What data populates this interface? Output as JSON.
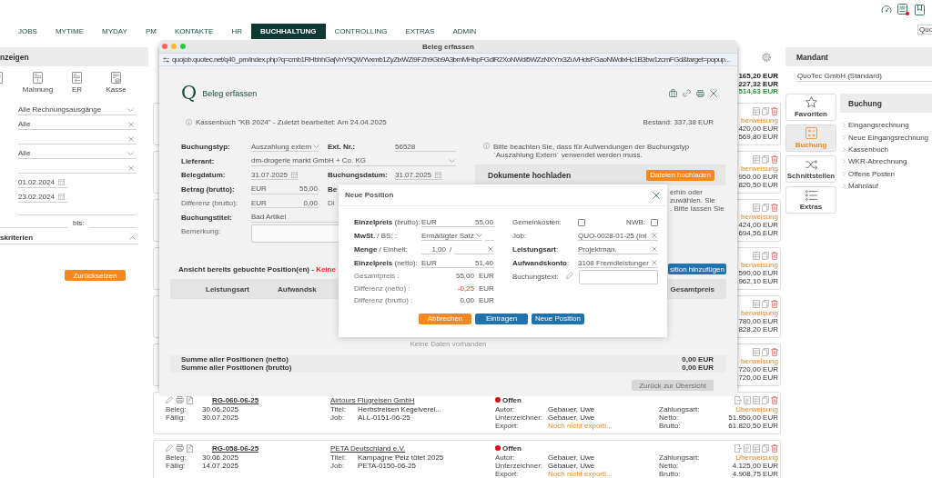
{
  "nav": {
    "tabs": [
      {
        "label": "JOBS",
        "selected": false
      },
      {
        "label": "MYTIME",
        "selected": false
      },
      {
        "label": "MYDAY",
        "selected": false
      },
      {
        "label": "PM",
        "selected": false
      },
      {
        "label": "KONTAKTE",
        "selected": false
      },
      {
        "label": "HR",
        "selected": false
      },
      {
        "label": "BUCHHALTUNG",
        "selected": true
      },
      {
        "label": "CONTROLLING",
        "selected": false
      },
      {
        "label": "EXTRAS",
        "selected": false
      },
      {
        "label": "ADMIN",
        "selected": false
      }
    ],
    "notification": true,
    "company_field": "Quo"
  },
  "left_panel": {
    "title": "nzeigen",
    "shortcuts": [
      "Mahnung",
      "ER",
      "Kasse"
    ],
    "filters": [
      {
        "kind": "select",
        "value": "Alle Rechnungsausgänge"
      },
      {
        "kind": "clearable",
        "value": "Alle"
      },
      {
        "kind": "clearable"
      },
      {
        "kind": "select",
        "value": "Alle"
      },
      {
        "kind": "clearable"
      },
      {
        "kind": "date",
        "value": "01.02.2024"
      },
      {
        "kind": "date",
        "value": "23.02.2024"
      },
      {
        "kind": "text"
      },
      {
        "kind": "range",
        "label": "bis:"
      }
    ],
    "section": {
      "title": "skriterien",
      "expanded": true
    },
    "reset_button": "Zurücksetzen"
  },
  "invoices": {
    "totals": [
      {
        "value": "165,20 EUR",
        "color": "#222222"
      },
      {
        "value": "227,32 EUR",
        "color": "#222222"
      },
      {
        "value": "514,63 EUR",
        "color": "#2e9b38"
      }
    ],
    "rows": [
      {
        "amounts": [
          {
            "value": "berweisung",
            "highlight": true
          },
          {
            "value": "420,00 EUR",
            "highlight": false
          },
          {
            "value": "569,80 EUR",
            "highlight": false
          }
        ]
      },
      {
        "amounts": [
          {
            "value": "berweisung",
            "highlight": true
          },
          {
            "value": "950,00 EUR",
            "highlight": false
          },
          {
            "value": "820,50 EUR",
            "highlight": false
          }
        ]
      },
      {
        "amounts": [
          {
            "value": "berweisung",
            "highlight": true
          },
          {
            "value": "424,00 EUR",
            "highlight": false
          },
          {
            "value": "694,56 EUR",
            "highlight": false
          }
        ]
      },
      {
        "amounts": [
          {
            "value": "berweisung",
            "highlight": true
          },
          {
            "value": "590,00 EUR",
            "highlight": false
          },
          {
            "value": "962,10 EUR",
            "highlight": false
          }
        ]
      },
      {
        "amounts": [
          {
            "value": "berweisung",
            "highlight": true
          },
          {
            "value": "780,00 EUR",
            "highlight": false
          },
          {
            "value": "828,20 EUR",
            "highlight": false
          }
        ]
      },
      {
        "amounts": [
          {
            "value": "berweisung",
            "highlight": true
          },
          {
            "value": "720,00 EUR",
            "highlight": false
          },
          {
            "value": "720,00 EUR",
            "highlight": false
          }
        ]
      },
      {
        "number": "RG-060-06-25",
        "company": "Airtours Flugreisen GmbH",
        "status": {
          "label": "Offen",
          "color": "#e30613"
        },
        "details": [
          [
            {
              "label": "Beleg:",
              "value": "30.06.2025",
              "highlight": false
            },
            {
              "label": "Fällig:",
              "value": "30.07.2025",
              "highlight": false
            }
          ],
          [
            {
              "label": "Titel:",
              "value": "Herbstreisen Kegelverei...",
              "highlight": false
            },
            {
              "label": "Job:",
              "value": "ALL-0151-06-25",
              "highlight": false
            }
          ],
          [
            {
              "label": "Autor:",
              "value": "Gebauer, Uwe",
              "highlight": false
            },
            {
              "label": "Unterzeichner:",
              "value": "Gebauer, Uwe",
              "highlight": false
            },
            {
              "label": "Export:",
              "value": "Noch nicht exporti...",
              "highlight": true
            }
          ]
        ],
        "amounts": [
          {
            "label": "Zahlungsart:",
            "value": "Überweisung",
            "highlight": true
          },
          {
            "label": "Netto:",
            "value": "51.950,00 EUR",
            "highlight": false
          },
          {
            "label": "Brutto:",
            "value": "61.820,50 EUR",
            "highlight": false
          }
        ]
      },
      {
        "number": "RG-058-06-25",
        "company": "PETA Deutschland e.V.",
        "status": {
          "label": "Offen",
          "color": "#e30613"
        },
        "details": [
          [
            {
              "label": "Beleg:",
              "value": "30.06.2025",
              "highlight": false
            },
            {
              "label": "Fällig:",
              "value": "14.07.2025",
              "highlight": false
            }
          ],
          [
            {
              "label": "Titel:",
              "value": "Kampagne Pelz tötet 2025",
              "highlight": false
            },
            {
              "label": "Job:",
              "value": "PETA-0150-06-25",
              "highlight": false
            }
          ],
          [
            {
              "label": "Autor:",
              "value": "Gebauer, Uwe",
              "highlight": false
            },
            {
              "label": "Unterzeichner:",
              "value": "Gebauer, Uwe",
              "highlight": false
            },
            {
              "label": "Export:",
              "value": "Noch nicht exporti...",
              "highlight": true
            }
          ]
        ],
        "amounts": [
          {
            "label": "Zahlungsart:",
            "value": "Überweisung",
            "highlight": true
          },
          {
            "label": "Netto:",
            "value": "4.125,00 EUR",
            "highlight": false
          },
          {
            "label": "Brutto:",
            "value": "4.908,75 EUR",
            "highlight": false
          }
        ]
      }
    ]
  },
  "client_panel": {
    "title": "Mandant",
    "value": "QuoTec GmbH (Standard)",
    "tiles": [
      {
        "label": "Favoriten",
        "selected": false
      },
      {
        "label": "Buchung",
        "selected": true
      },
      {
        "label": "Schnittstellen",
        "selected": false
      },
      {
        "label": "Extras",
        "selected": false
      }
    ],
    "menu": {
      "title": "Buchung",
      "items": [
        "Eingangsrechnung",
        "Neue Eingangsrechnung",
        "Kassenbuch",
        "WKR-Abrechnung",
        "Offene Posten",
        "Mahnlauf"
      ]
    }
  },
  "popup": {
    "title": "Beleg erfassen",
    "url": "quojob.quotec.net/q40_pm/index.php?q=cmb1RHbhhGajVnY9QWYvxmb1ZyZlxWZi9FZh9Gb9A3bmMHbpFGdlR2XoNWdi5WZzNXYrx3ZuVHdsFGaoNWdixHc1B3bw1zcmFGd&target=popup...",
    "logo": "Q",
    "heading": "Beleg erfassen",
    "info": "Kassenbuch \"KB 2024\" - Zuletzt bearbeitet: Am 24.04.2025",
    "balance": "Bestand: 337,38 EUR",
    "form": [
      [
        {
          "kind": "select",
          "label": "Buchungstyp:",
          "required": true,
          "value": "Auszahlung extern"
        },
        {
          "kind": "text",
          "label": "Ext. Nr.:",
          "required": true,
          "value": "56528"
        }
      ],
      [
        {
          "kind": "select",
          "label": "Lieferant:",
          "required": true,
          "value": "dm-drogerie markt GmbH + Co. KG"
        }
      ],
      [
        {
          "kind": "date",
          "label": "Belegdatum:",
          "required": true,
          "value": "31.07.2025"
        },
        {
          "kind": "date",
          "label": "Buchungsdatum:",
          "required": true,
          "value": "31.07.2025"
        }
      ],
      [
        {
          "kind": "amount",
          "label": "Betrag (brutto):",
          "required": true,
          "currency": "EUR",
          "value": "55,00"
        },
        {
          "kind": "label",
          "label": "Be",
          "required": true
        }
      ],
      [
        {
          "kind": "amount",
          "label": "Differenz (brutto):",
          "required": false,
          "currency": "EUR",
          "value": "0,00"
        },
        {
          "kind": "label",
          "label": "Di",
          "required": false
        }
      ],
      [
        {
          "kind": "text",
          "label": "Buchungstitel:",
          "required": true,
          "value": "Bad Artikel"
        }
      ],
      [
        {
          "kind": "textarea",
          "label": "Bemerkung:",
          "required": false
        }
      ]
    ],
    "notice": "Bitte beachten Sie, dass für Aufwendungen der Buchungstyp `Auszahlung Extern´ verwendet werden muss.",
    "documents": {
      "title": "Dokumente hochladen",
      "button": "Dateien hochladen",
      "hint": [
        "erhin oder",
        "zuwählen. Sie",
        ". Bitte lassen Sie"
      ]
    },
    "positions": {
      "title": "Ansicht bereits gebuchte Position(en) - ",
      "alert": "Keine",
      "add_button": "sition hinzufügen",
      "columns": [
        "Leistungsart",
        "Aufwandsk",
        "Gesamtpreis"
      ],
      "empty": "Keine Daten vorhanden",
      "sums": [
        {
          "label": "Summe aller Positionen (netto)",
          "value": "0,00 EUR"
        },
        {
          "label": "Summe aller Positionen (brutto)",
          "value": "0,00 EUR"
        }
      ]
    },
    "back_button": {
      "label": "Zurück zur Übersicht",
      "disabled": true
    },
    "modal": {
      "title": "Neue Position",
      "left": [
        {
          "kind": "amount",
          "label": "**Einzelpreis** (brutto):",
          "currency": "EUR",
          "value": "55,00"
        },
        {
          "kind": "select",
          "label": "**MwSt.** / BS: :",
          "value": "Ermäßigter Satz"
        },
        {
          "kind": "quantity",
          "label": "**Menge** / Einheit:",
          "value": "1,00",
          "separator": "/"
        },
        {
          "kind": "amount",
          "label": "**Einzelpreis** (netto):",
          "currency": "EUR",
          "value": "51,40"
        },
        {
          "kind": "sum",
          "label": "Gesamtpreis :",
          "value": "55,00",
          "currency": "EUR",
          "negative": false
        },
        {
          "kind": "sum",
          "label": "Differenz (netto) :",
          "value": "-0,25",
          "currency": "EUR",
          "negative": true
        },
        {
          "kind": "sum",
          "label": "Differenz (brutto) :",
          "value": "0,00",
          "currency": "EUR",
          "negative": false
        }
      ],
      "right": [
        {
          "kind": "checks",
          "label": "Gemeinkosten:",
          "checked": false,
          "label2": "NWB:",
          "checked2": false
        },
        {
          "kind": "clearable",
          "label": "Job:",
          "value": "QUO-0028-01-25 (Int"
        },
        {
          "kind": "clearable",
          "label": "**Leistungsart**:",
          "value": "Projektman."
        },
        {
          "kind": "clearable",
          "label": "**Aufwandskonto**:",
          "value": "3108 Fremdleistunger"
        },
        {
          "kind": "textarea",
          "label": "Buchungstext:"
        }
      ],
      "buttons": [
        {
          "label": "Abbrechen",
          "kind": "cancel"
        },
        {
          "label": "Eintragen",
          "kind": "primary"
        },
        {
          "label": "Neue Position",
          "kind": "primary"
        }
      ]
    }
  }
}
